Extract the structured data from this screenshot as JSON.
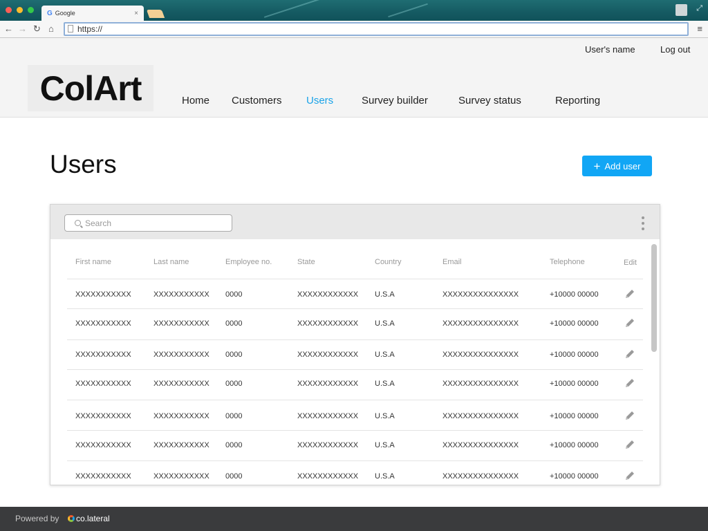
{
  "browser": {
    "tab_title": "Google",
    "tab_icon": "google-g-icon",
    "tab_close": "×",
    "url": "https://",
    "nav_back": "←",
    "nav_forward": "→",
    "nav_reload": "↻",
    "nav_home": "⌂",
    "menu": "≡"
  },
  "header": {
    "logo": "ColArt",
    "user_name": "User's name",
    "logout": "Log out",
    "nav": [
      {
        "label": "Home",
        "active": false
      },
      {
        "label": "Customers",
        "active": false
      },
      {
        "label": "Users",
        "active": true
      },
      {
        "label": "Survey builder",
        "active": false
      },
      {
        "label": "Survey status",
        "active": false
      },
      {
        "label": "Reporting",
        "active": false
      }
    ]
  },
  "page": {
    "title": "Users",
    "add_button": "Add user",
    "add_icon": "+"
  },
  "table": {
    "search_placeholder": "Search",
    "columns": [
      "First name",
      "Last name",
      "Employee no.",
      "State",
      "Country",
      "Email",
      "Telephone",
      "Edit"
    ],
    "rows": [
      [
        "XXXXXXXXXXX",
        "XXXXXXXXXXX",
        "0000",
        "XXXXXXXXXXXX",
        "U.S.A",
        "XXXXXXXXXXXXXXX",
        "+10000 00000"
      ],
      [
        "XXXXXXXXXXX",
        "XXXXXXXXXXX",
        "0000",
        "XXXXXXXXXXXX",
        "U.S.A",
        "XXXXXXXXXXXXXXX",
        "+10000 00000"
      ],
      [
        "XXXXXXXXXXX",
        "XXXXXXXXXXX",
        "0000",
        "XXXXXXXXXXXX",
        "U.S.A",
        "XXXXXXXXXXXXXXX",
        "+10000 00000"
      ],
      [
        "XXXXXXXXXXX",
        "XXXXXXXXXXX",
        "0000",
        "XXXXXXXXXXXX",
        "U.S.A",
        "XXXXXXXXXXXXXXX",
        "+10000 00000"
      ],
      [
        "XXXXXXXXXXX",
        "XXXXXXXXXXX",
        "0000",
        "XXXXXXXXXXXX",
        "U.S.A",
        "XXXXXXXXXXXXXXX",
        "+10000 00000"
      ],
      [
        "XXXXXXXXXXX",
        "XXXXXXXXXXX",
        "0000",
        "XXXXXXXXXXXX",
        "U.S.A",
        "XXXXXXXXXXXXXXX",
        "+10000 00000"
      ],
      [
        "XXXXXXXXXXX",
        "XXXXXXXXXXX",
        "0000",
        "XXXXXXXXXXXX",
        "U.S.A",
        "XXXXXXXXXXXXXXX",
        "+10000 00000"
      ]
    ]
  },
  "footer": {
    "powered_by": "Powered by",
    "brand": "co.lateral"
  },
  "colors": {
    "accent": "#11a6f5",
    "active_nav": "#1aa3e8",
    "footer_bg": "#3a3b3d"
  }
}
